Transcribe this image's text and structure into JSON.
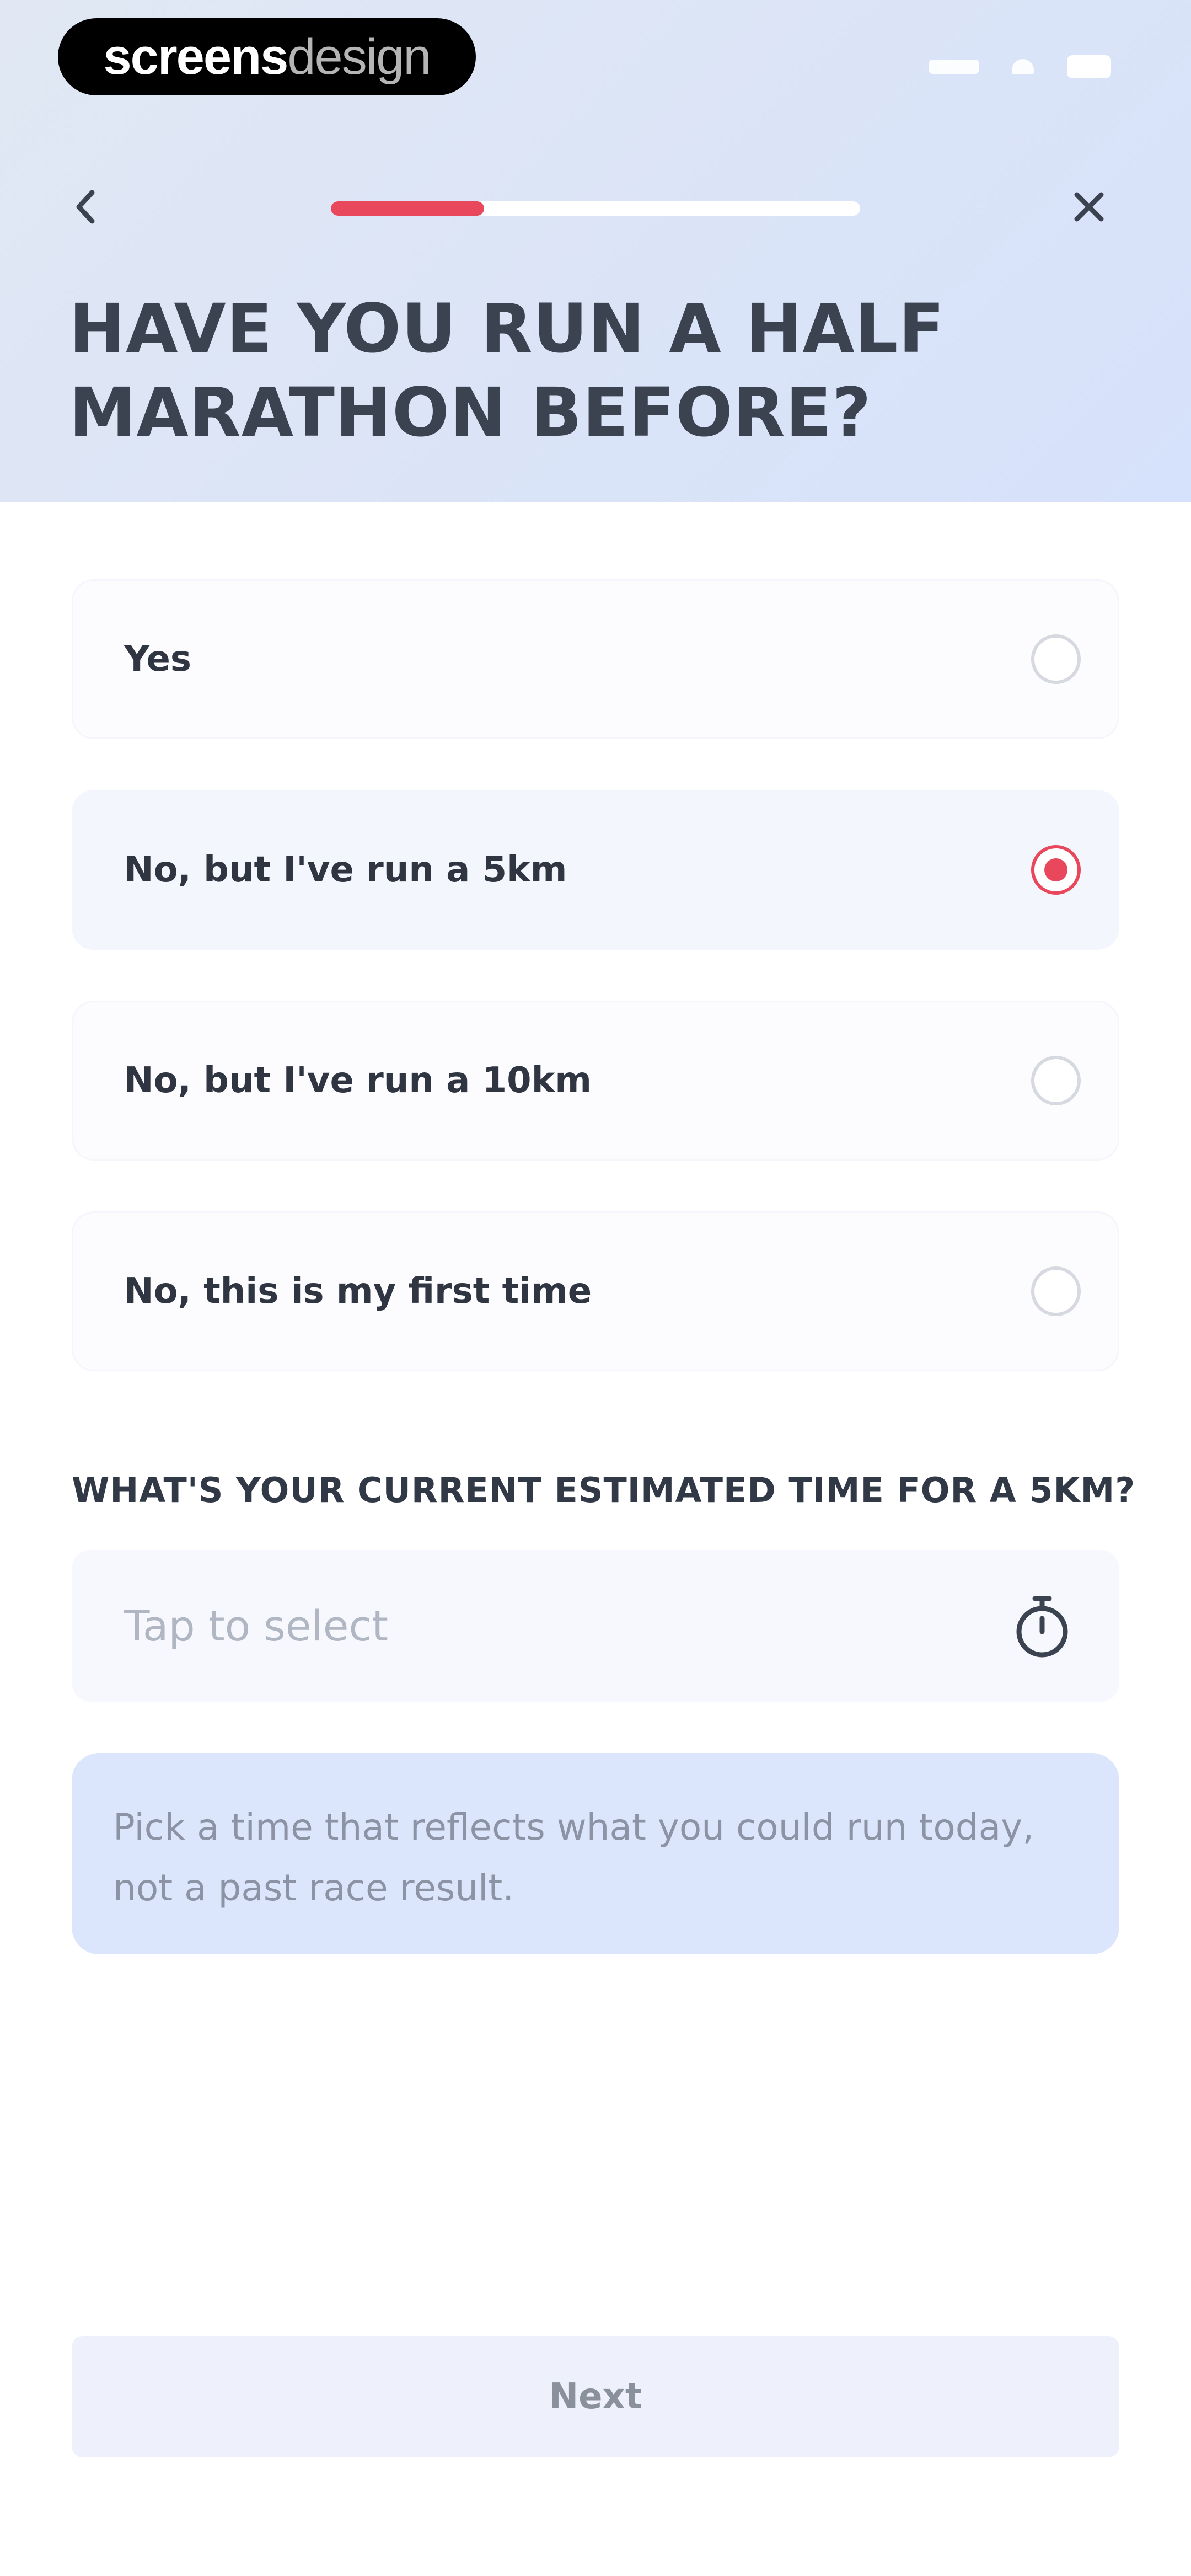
{
  "brand": {
    "part1": "screens",
    "part2": "design"
  },
  "nav": {
    "progress": 0.29
  },
  "header": {
    "title": "HAVE YOU RUN A HALF MARATHON BEFORE?"
  },
  "options": [
    {
      "label": "Yes",
      "selected": false
    },
    {
      "label": "No, but I've run a 5km",
      "selected": true
    },
    {
      "label": "No, but I've run a 10km",
      "selected": false
    },
    {
      "label": "No, this is my first time",
      "selected": false
    }
  ],
  "time_question": {
    "label": "WHAT'S YOUR CURRENT ESTIMATED TIME FOR A 5KM?",
    "placeholder": "Tap to select",
    "icon": "stopwatch-icon"
  },
  "hint": {
    "text": "Pick a time that reflects what you could run today, not a past race result."
  },
  "footer": {
    "next_label": "Next"
  },
  "colors": {
    "accent": "#e9475c",
    "hero_background": "#dbe4f7",
    "hint_background": "#dbe5fb",
    "button_background": "#eef1fb"
  }
}
